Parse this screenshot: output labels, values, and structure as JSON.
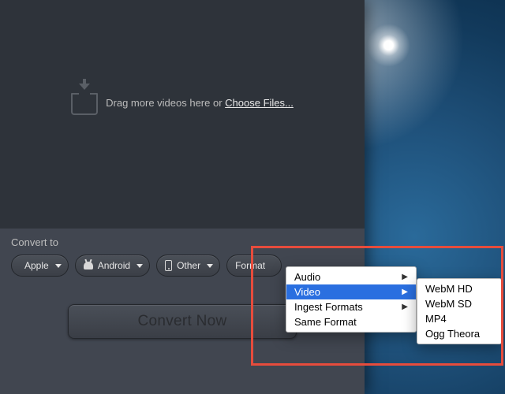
{
  "dropzone": {
    "text_prefix": "Drag more videos here or ",
    "choose_label": "Choose Files..."
  },
  "convert_to_label": "Convert to",
  "buttons": {
    "apple": "Apple",
    "android": "Android",
    "other": "Other",
    "format": "Format"
  },
  "convert_now": "Convert Now",
  "format_menu": {
    "items": [
      {
        "label": "Audio",
        "has_sub": true
      },
      {
        "label": "Video",
        "has_sub": true,
        "selected": true
      },
      {
        "label": "Ingest Formats",
        "has_sub": true
      },
      {
        "label": "Same Format",
        "has_sub": false
      }
    ]
  },
  "video_submenu": {
    "items": [
      {
        "label": "WebM HD"
      },
      {
        "label": "WebM SD"
      },
      {
        "label": "MP4"
      },
      {
        "label": "Ogg Theora"
      }
    ]
  }
}
